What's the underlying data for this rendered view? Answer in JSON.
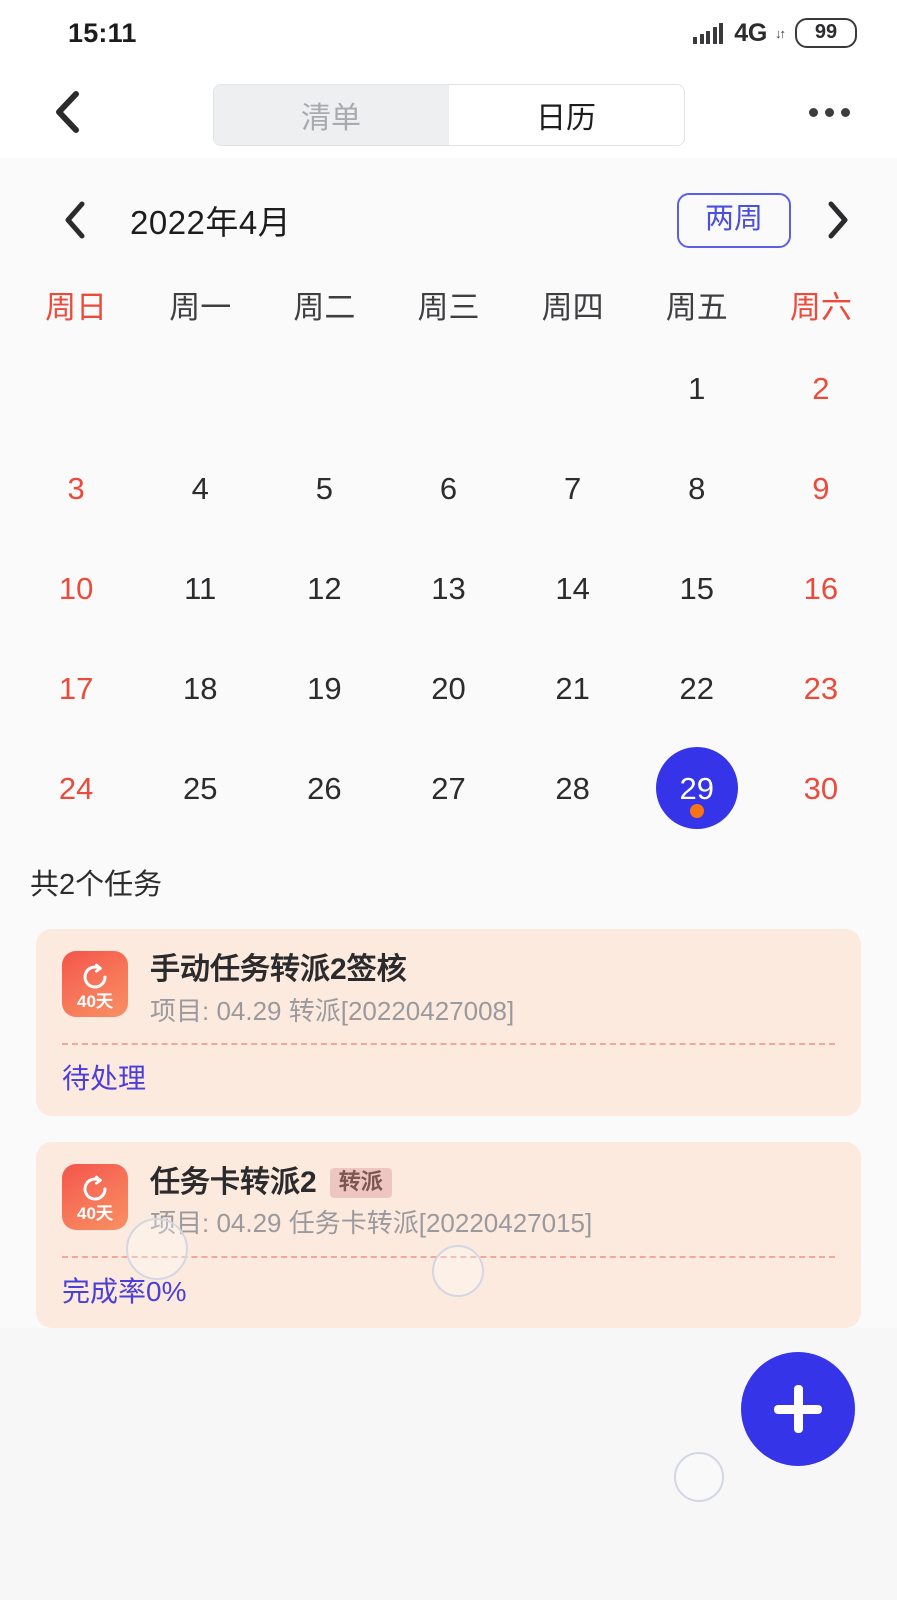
{
  "status_bar": {
    "time": "15:11",
    "network_label": "4G",
    "network_arrows": "↓↑",
    "battery_level": "99",
    "signal_icon": "signal-bars-icon"
  },
  "nav_bar": {
    "back_icon": "chevron-left-icon",
    "more_icon": "more-horizontal-icon",
    "tabs": [
      {
        "label": "清单",
        "active": false
      },
      {
        "label": "日历",
        "active": true
      }
    ]
  },
  "calendar": {
    "prev_icon": "chevron-left-icon",
    "next_icon": "chevron-right-icon",
    "title": "2022年4月",
    "range_toggle_label": "两周",
    "weekdays": [
      {
        "label": "周日",
        "weekend": true
      },
      {
        "label": "周一",
        "weekend": false
      },
      {
        "label": "周二",
        "weekend": false
      },
      {
        "label": "周三",
        "weekend": false
      },
      {
        "label": "周四",
        "weekend": false
      },
      {
        "label": "周五",
        "weekend": false
      },
      {
        "label": "周六",
        "weekend": true
      }
    ],
    "rows": [
      [
        "",
        "",
        "",
        "",
        "",
        "1",
        "2"
      ],
      [
        "3",
        "4",
        "5",
        "6",
        "7",
        "8",
        "9"
      ],
      [
        "10",
        "11",
        "12",
        "13",
        "14",
        "15",
        "16"
      ],
      [
        "17",
        "18",
        "19",
        "20",
        "21",
        "22",
        "23"
      ],
      [
        "24",
        "25",
        "26",
        "27",
        "28",
        "29",
        "30"
      ]
    ],
    "selected_day": "29",
    "selected_has_event": true,
    "accent_color": "#3634e8",
    "weekend_color": "#ec4b3c",
    "event_dot_color": "#f97416"
  },
  "task_section": {
    "count_label": "共2个任务",
    "tasks": [
      {
        "icon_name": "countdown-timer-icon",
        "icon_days": "40天",
        "title": "手动任务转派2签核",
        "tag": "",
        "subtitle": "项目: 04.29 转派[20220427008]",
        "status": "待处理"
      },
      {
        "icon_name": "countdown-timer-icon",
        "icon_days": "40天",
        "title": "任务卡转派2",
        "tag": "转派",
        "subtitle": "项目: 04.29 任务卡转派[20220427015]",
        "status": "完成率0%"
      }
    ]
  },
  "fab": {
    "icon": "plus-icon",
    "color": "#3634e8"
  }
}
